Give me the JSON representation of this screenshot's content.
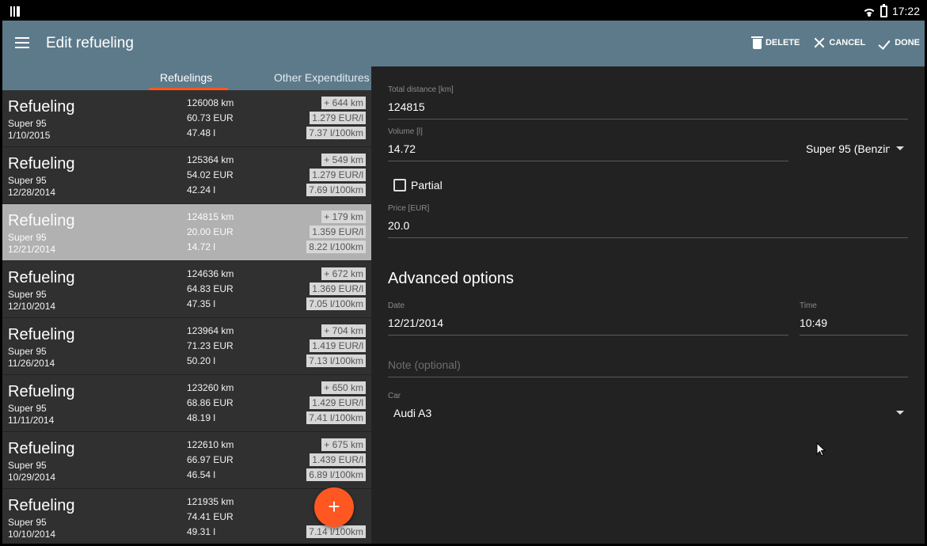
{
  "status_bar": {
    "time": "17:22"
  },
  "app_bar": {
    "title": "Edit refueling",
    "actions": {
      "delete": "DELETE",
      "cancel": "CANCEL",
      "done": "DONE"
    }
  },
  "tabs": [
    {
      "label": "Refuelings"
    },
    {
      "label": "Other Expenditures"
    }
  ],
  "list": [
    {
      "title": "Refueling",
      "fuel": "Super 95",
      "date": "1/10/2015",
      "mileage": "126008 km",
      "cost": "60.73 EUR",
      "volume": "47.48 l",
      "distance": "+ 644 km",
      "price": "1.279 EUR/l",
      "consumption": "7.37 l/100km"
    },
    {
      "title": "Refueling",
      "fuel": "Super 95",
      "date": "12/28/2014",
      "mileage": "125364 km",
      "cost": "54.02 EUR",
      "volume": "42.24 l",
      "distance": "+ 549 km",
      "price": "1.279 EUR/l",
      "consumption": "7.69 l/100km"
    },
    {
      "title": "Refueling",
      "fuel": "Super 95",
      "date": "12/21/2014",
      "mileage": "124815 km",
      "cost": "20.00 EUR",
      "volume": "14.72 l",
      "distance": "+ 179 km",
      "price": "1.359 EUR/l",
      "consumption": "8.22 l/100km"
    },
    {
      "title": "Refueling",
      "fuel": "Super 95",
      "date": "12/10/2014",
      "mileage": "124636 km",
      "cost": "64.83 EUR",
      "volume": "47.35 l",
      "distance": "+ 672 km",
      "price": "1.369 EUR/l",
      "consumption": "7.05 l/100km"
    },
    {
      "title": "Refueling",
      "fuel": "Super 95",
      "date": "11/26/2014",
      "mileage": "123964 km",
      "cost": "71.23 EUR",
      "volume": "50.20 l",
      "distance": "+ 704 km",
      "price": "1.419 EUR/l",
      "consumption": "7.13 l/100km"
    },
    {
      "title": "Refueling",
      "fuel": "Super 95",
      "date": "11/11/2014",
      "mileage": "123260 km",
      "cost": "68.86 EUR",
      "volume": "48.19 l",
      "distance": "+ 650 km",
      "price": "1.429 EUR/l",
      "consumption": "7.41 l/100km"
    },
    {
      "title": "Refueling",
      "fuel": "Super 95",
      "date": "10/29/2014",
      "mileage": "122610 km",
      "cost": "66.97 EUR",
      "volume": "46.54 l",
      "distance": "+ 675 km",
      "price": "1.439 EUR/l",
      "consumption": "6.89 l/100km"
    },
    {
      "title": "Refueling",
      "fuel": "Super 95",
      "date": "10/10/2014",
      "mileage": "121935 km",
      "cost": "74.41 EUR",
      "volume": "49.31 l",
      "distance": "",
      "price": "",
      "consumption": "7.14 l/100km"
    }
  ],
  "fab_label": "+",
  "form": {
    "total_distance": {
      "label": "Total distance [km]",
      "value": "124815"
    },
    "volume": {
      "label": "Volume [l]",
      "value": "14.72"
    },
    "fuel_type": {
      "value": "Super 95 (Benzin"
    },
    "partial": {
      "label": "Partial",
      "checked": false
    },
    "price": {
      "label": "Price [EUR]",
      "value": "20.0"
    },
    "advanced_title": "Advanced options",
    "date": {
      "label": "Date",
      "value": "12/21/2014"
    },
    "time": {
      "label": "Time",
      "value": "10:49"
    },
    "note": {
      "placeholder": "Note (optional)"
    },
    "car": {
      "label": "Car",
      "value": "Audi A3"
    }
  }
}
